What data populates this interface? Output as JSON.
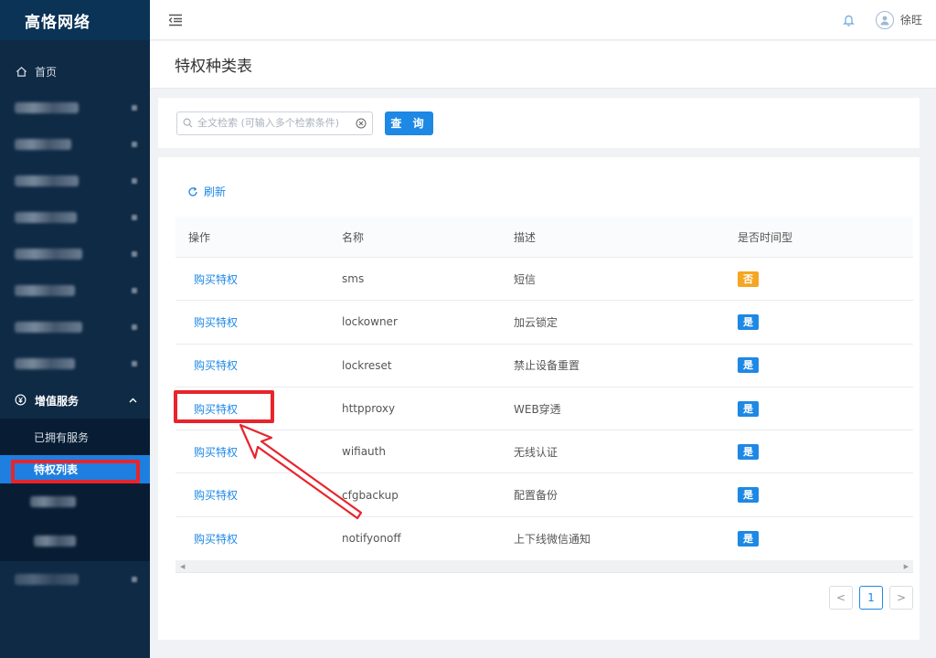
{
  "app": {
    "logo": "高恪网络"
  },
  "sidebar": {
    "home_label": "首页",
    "blurred_items": [
      {
        "w": 70
      },
      {
        "w": 62
      },
      {
        "w": 70
      },
      {
        "w": 68
      },
      {
        "w": 74
      },
      {
        "w": 66
      },
      {
        "w": 74
      },
      {
        "w": 66
      }
    ],
    "group": {
      "label": "增值服务",
      "items": {
        "owned": "已拥有服务",
        "privilege_list": "特权列表"
      }
    }
  },
  "header": {
    "username": "徐旺"
  },
  "page": {
    "title": "特权种类表"
  },
  "search": {
    "placeholder": "全文检索 (可输入多个检索条件)",
    "query_label": "查 询"
  },
  "table": {
    "refresh_label": "刷新",
    "columns": {
      "action": "操作",
      "name": "名称",
      "desc": "描述",
      "is_time": "是否时间型"
    },
    "rows": [
      {
        "action": "购买特权",
        "name": "sms",
        "desc": "短信",
        "is_time": "否"
      },
      {
        "action": "购买特权",
        "name": "lockowner",
        "desc": "加云锁定",
        "is_time": "是"
      },
      {
        "action": "购买特权",
        "name": "lockreset",
        "desc": "禁止设备重置",
        "is_time": "是"
      },
      {
        "action": "购买特权",
        "name": "httpproxy",
        "desc": "WEB穿透",
        "is_time": "是"
      },
      {
        "action": "购买特权",
        "name": "wifiauth",
        "desc": "无线认证",
        "is_time": "是"
      },
      {
        "action": "购买特权",
        "name": "cfgbackup",
        "desc": "配置备份",
        "is_time": "是"
      },
      {
        "action": "购买特权",
        "name": "notifyonoff",
        "desc": "上下线微信通知",
        "is_time": "是"
      }
    ]
  },
  "pager": {
    "current": "1",
    "prev": "<",
    "next": ">"
  },
  "colors": {
    "accent": "#1e88e5",
    "sidebar_bg": "#0f2a45",
    "tag_no": "#f5a623",
    "annotation": "#e8242c"
  }
}
